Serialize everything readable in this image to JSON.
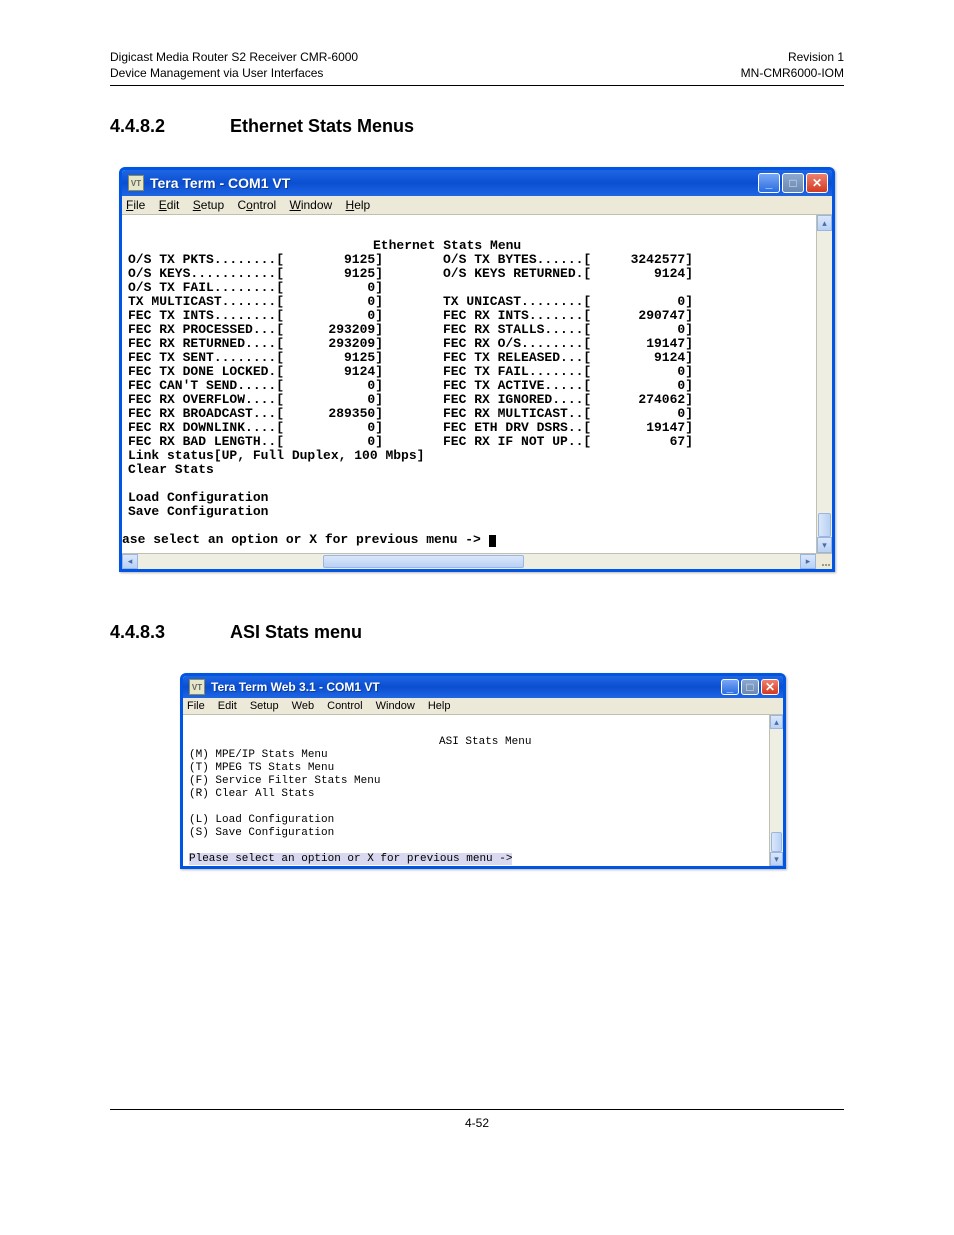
{
  "header": {
    "left1": "Digicast Media Router S2 Receiver CMR-6000",
    "left2": "Device Management via User Interfaces",
    "right1": "Revision 1",
    "right2": "MN-CMR6000-IOM"
  },
  "section1": {
    "num": "4.4.8.2",
    "title": "Ethernet Stats Menus"
  },
  "section2": {
    "num": "4.4.8.3",
    "title": "ASI Stats menu"
  },
  "footer": {
    "page": "4-52"
  },
  "win1": {
    "title": "Tera Term - COM1 VT",
    "menus": [
      "File",
      "Edit",
      "Setup",
      "Control",
      "Window",
      "Help"
    ],
    "heading": "Ethernet Stats Menu",
    "rows": [
      {
        "lL": "O/S TX PKTS........[",
        "vL": "9125]",
        "lR": "O/S TX BYTES......[",
        "vR": "3242577]"
      },
      {
        "lL": "O/S KEYS...........[",
        "vL": "9125]",
        "lR": "O/S KEYS RETURNED.[",
        "vR": "9124]"
      },
      {
        "lL": "O/S TX FAIL........[",
        "vL": "0]",
        "lR": "",
        "vR": ""
      },
      {
        "lL": "TX MULTICAST.......[",
        "vL": "0]",
        "lR": "TX UNICAST........[",
        "vR": "0]"
      },
      {
        "lL": "FEC TX INTS........[",
        "vL": "0]",
        "lR": "FEC RX INTS.......[",
        "vR": "290747]"
      },
      {
        "lL": "FEC RX PROCESSED...[",
        "vL": "293209]",
        "lR": "FEC RX STALLS.....[",
        "vR": "0]"
      },
      {
        "lL": "FEC RX RETURNED....[",
        "vL": "293209]",
        "lR": "FEC RX O/S........[",
        "vR": "19147]"
      },
      {
        "lL": "FEC TX SENT........[",
        "vL": "9125]",
        "lR": "FEC TX RELEASED...[",
        "vR": "9124]"
      },
      {
        "lL": "FEC TX DONE LOCKED.[",
        "vL": "9124]",
        "lR": "FEC TX FAIL.......[",
        "vR": "0]"
      },
      {
        "lL": "FEC CAN'T SEND.....[",
        "vL": "0]",
        "lR": "FEC TX ACTIVE.....[",
        "vR": "0]"
      },
      {
        "lL": "FEC RX OVERFLOW....[",
        "vL": "0]",
        "lR": "FEC RX IGNORED....[",
        "vR": "274062]"
      },
      {
        "lL": "FEC RX BROADCAST...[",
        "vL": "289350]",
        "lR": "FEC RX MULTICAST..[",
        "vR": "0]"
      },
      {
        "lL": "FEC RX DOWNLINK....[",
        "vL": "0]",
        "lR": "FEC ETH DRV DSRS..[",
        "vR": "19147]"
      },
      {
        "lL": "FEC RX BAD LENGTH..[",
        "vL": "0]",
        "lR": "FEC RX IF NOT UP..[",
        "vR": "67]"
      }
    ],
    "linkstatus": "Link status[UP, Full Duplex, 100 Mbps]",
    "clear": "Clear Stats",
    "load": "Load Configuration",
    "save": "Save Configuration",
    "prompt": "ase select an option or X for previous menu -> "
  },
  "win2": {
    "title": "Tera Term Web 3.1 - COM1 VT",
    "menus": [
      "File",
      "Edit",
      "Setup",
      "Web",
      "Control",
      "Window",
      "Help"
    ],
    "heading": "ASI Stats Menu",
    "items": [
      "(M) MPE/IP Stats Menu",
      "(T) MPEG TS Stats Menu",
      "(F) Service Filter Stats Menu",
      "(R) Clear All Stats"
    ],
    "items2": [
      "(L) Load Configuration",
      "(S) Save Configuration"
    ],
    "prompt": "Please select an option or X for previous menu ->"
  }
}
